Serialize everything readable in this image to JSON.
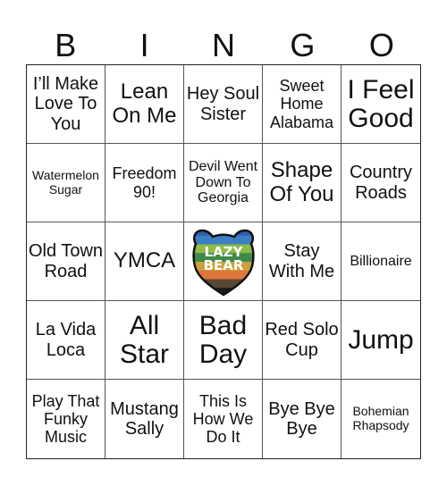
{
  "header": {
    "letters": [
      "B",
      "I",
      "N",
      "G",
      "O"
    ]
  },
  "free_space": {
    "logo_text_line1": "LAZY",
    "logo_text_line2": "BEAR",
    "icon": "lazy-bear-logo",
    "stripe_colors": [
      "#2f5fb0",
      "#3b7fc4",
      "#8dbb45",
      "#3f8a4a",
      "#c9a23a",
      "#e0763a",
      "#5a4634",
      "#1e1a16"
    ]
  },
  "cells": [
    "I’ll Make Love To You",
    "Lean On Me",
    "Hey Soul Sister",
    "Sweet Home Alabama",
    "I Feel Good",
    "Watermelon Sugar",
    "Freedom 90!",
    "Devil Went Down To Georgia",
    "Shape Of You",
    "Country Roads",
    "Old Town Road",
    "YMCA",
    "",
    "Stay With Me",
    "Billionaire",
    "La Vida Loca",
    "All Star",
    "Bad Day",
    "Red Solo Cup",
    "Jump",
    "Play That Funky Music",
    "Mustang Sally",
    "This Is How We Do It",
    "Bye Bye Bye",
    "Bohemian Rhapsody"
  ]
}
